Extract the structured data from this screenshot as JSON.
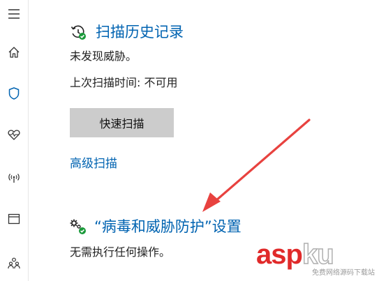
{
  "sidebar": {
    "items": [
      {
        "icon": "hamburger-menu-icon"
      },
      {
        "icon": "home-icon"
      },
      {
        "icon": "shield-icon"
      },
      {
        "icon": "heart-health-icon"
      },
      {
        "icon": "wireless-network-icon"
      },
      {
        "icon": "app-browser-window-icon"
      },
      {
        "icon": "family-people-icon"
      }
    ]
  },
  "scan_history": {
    "title": "扫描历史记录",
    "icon": "history-clock-check-icon",
    "status": "未发现威胁。",
    "last_scan": "上次扫描时间: 不可用",
    "quick_scan_label": "快速扫描",
    "advanced_scan_link": "高级扫描"
  },
  "virus_settings": {
    "title": "“病毒和威胁防护”设置",
    "icon": "gears-check-icon",
    "status": "无需执行任何操作。"
  },
  "annotation": {
    "color": "#e8423f"
  },
  "watermark": {
    "logo_a": "a",
    "logo_s": "s",
    "logo_p": "p",
    "logo_k": "k",
    "logo_u": "u",
    "subtitle": "免费网络源码下载站"
  },
  "colors": {
    "accent": "#0063b1",
    "button_bg": "#cccccc"
  }
}
